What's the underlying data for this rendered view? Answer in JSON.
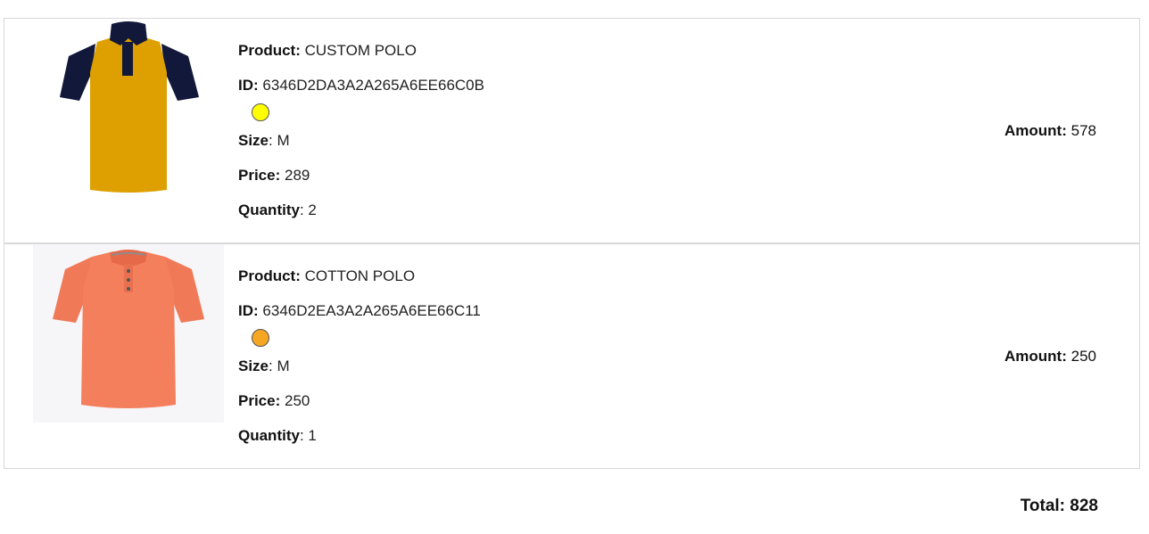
{
  "labels": {
    "product": "Product:",
    "id": "ID:",
    "size": "Size",
    "price": "Price:",
    "quantity": "Quantity",
    "amount": "Amount:",
    "total": "Total:"
  },
  "items": [
    {
      "product": "CUSTOM POLO",
      "id": "6346D2DA3A2A265A6EE66C0B",
      "color": "#ffff00",
      "size": "M",
      "price": "289",
      "quantity": "2",
      "amount": "578",
      "image_icon": "yellow-navy-polo-shirt"
    },
    {
      "product": "COTTON POLO",
      "id": "6346D2EA3A2A265A6EE66C11",
      "color": "#f5a623",
      "size": "M",
      "price": "250",
      "quantity": "1",
      "amount": "250",
      "image_icon": "coral-polo-shirt"
    }
  ],
  "total": "828"
}
